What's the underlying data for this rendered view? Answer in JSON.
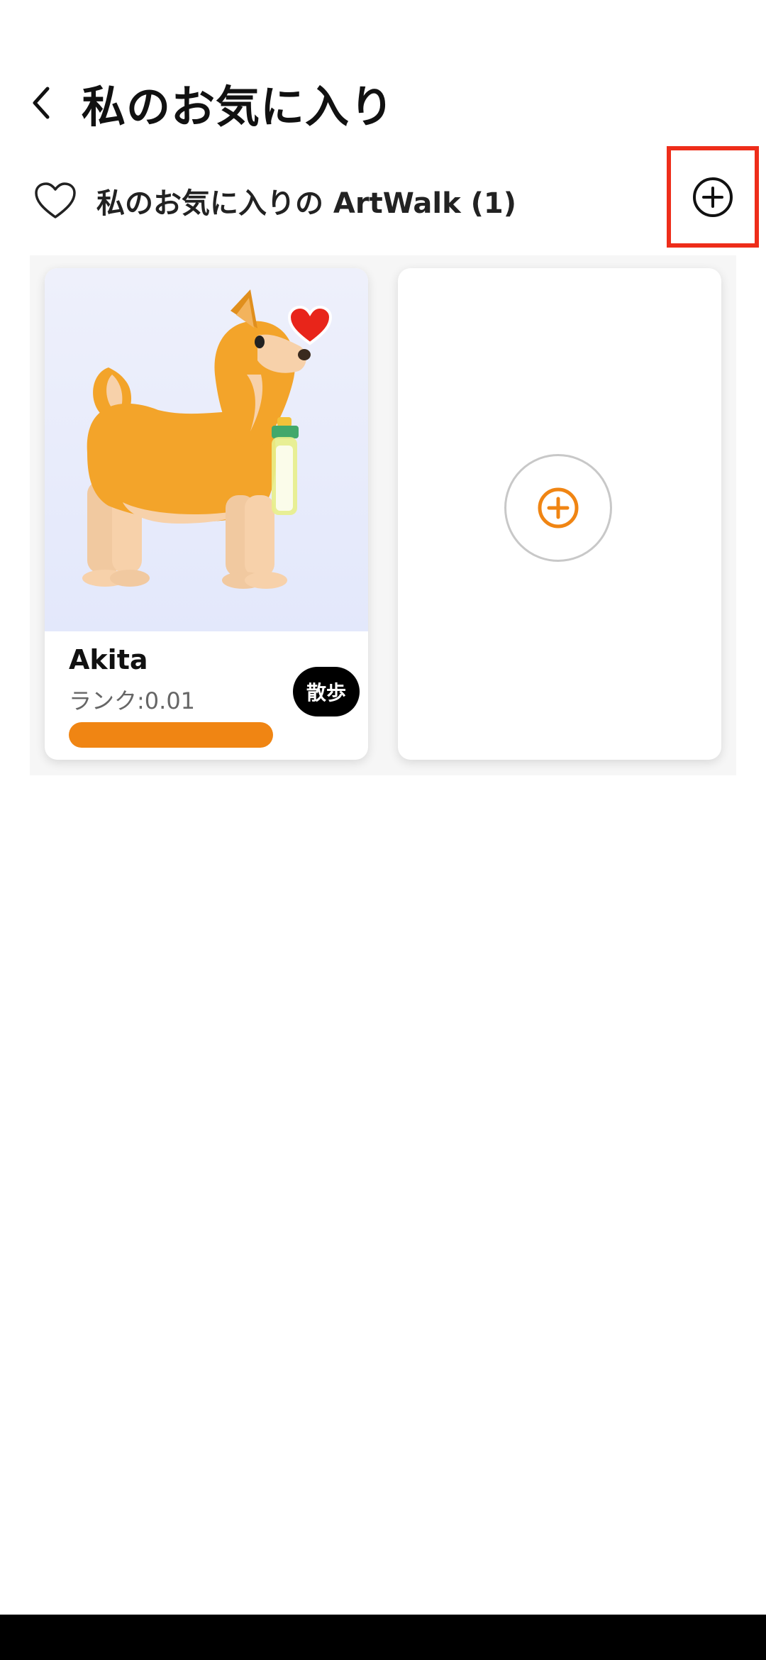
{
  "header": {
    "title": "私のお気に入り"
  },
  "section": {
    "title": "私のお気に入りの ArtWalk (1)"
  },
  "cards": [
    {
      "name": "Akita",
      "rank": "ランク:0.01",
      "walk_label": "散歩",
      "rank_progress": 1.0
    }
  ],
  "colors": {
    "accent": "#f08513",
    "heart": "#e8251a",
    "highlight_box": "#ee2d1a"
  },
  "icons": [
    "back-icon",
    "heart-outline-icon",
    "add-circle-icon",
    "heart-icon",
    "plus-icon"
  ]
}
